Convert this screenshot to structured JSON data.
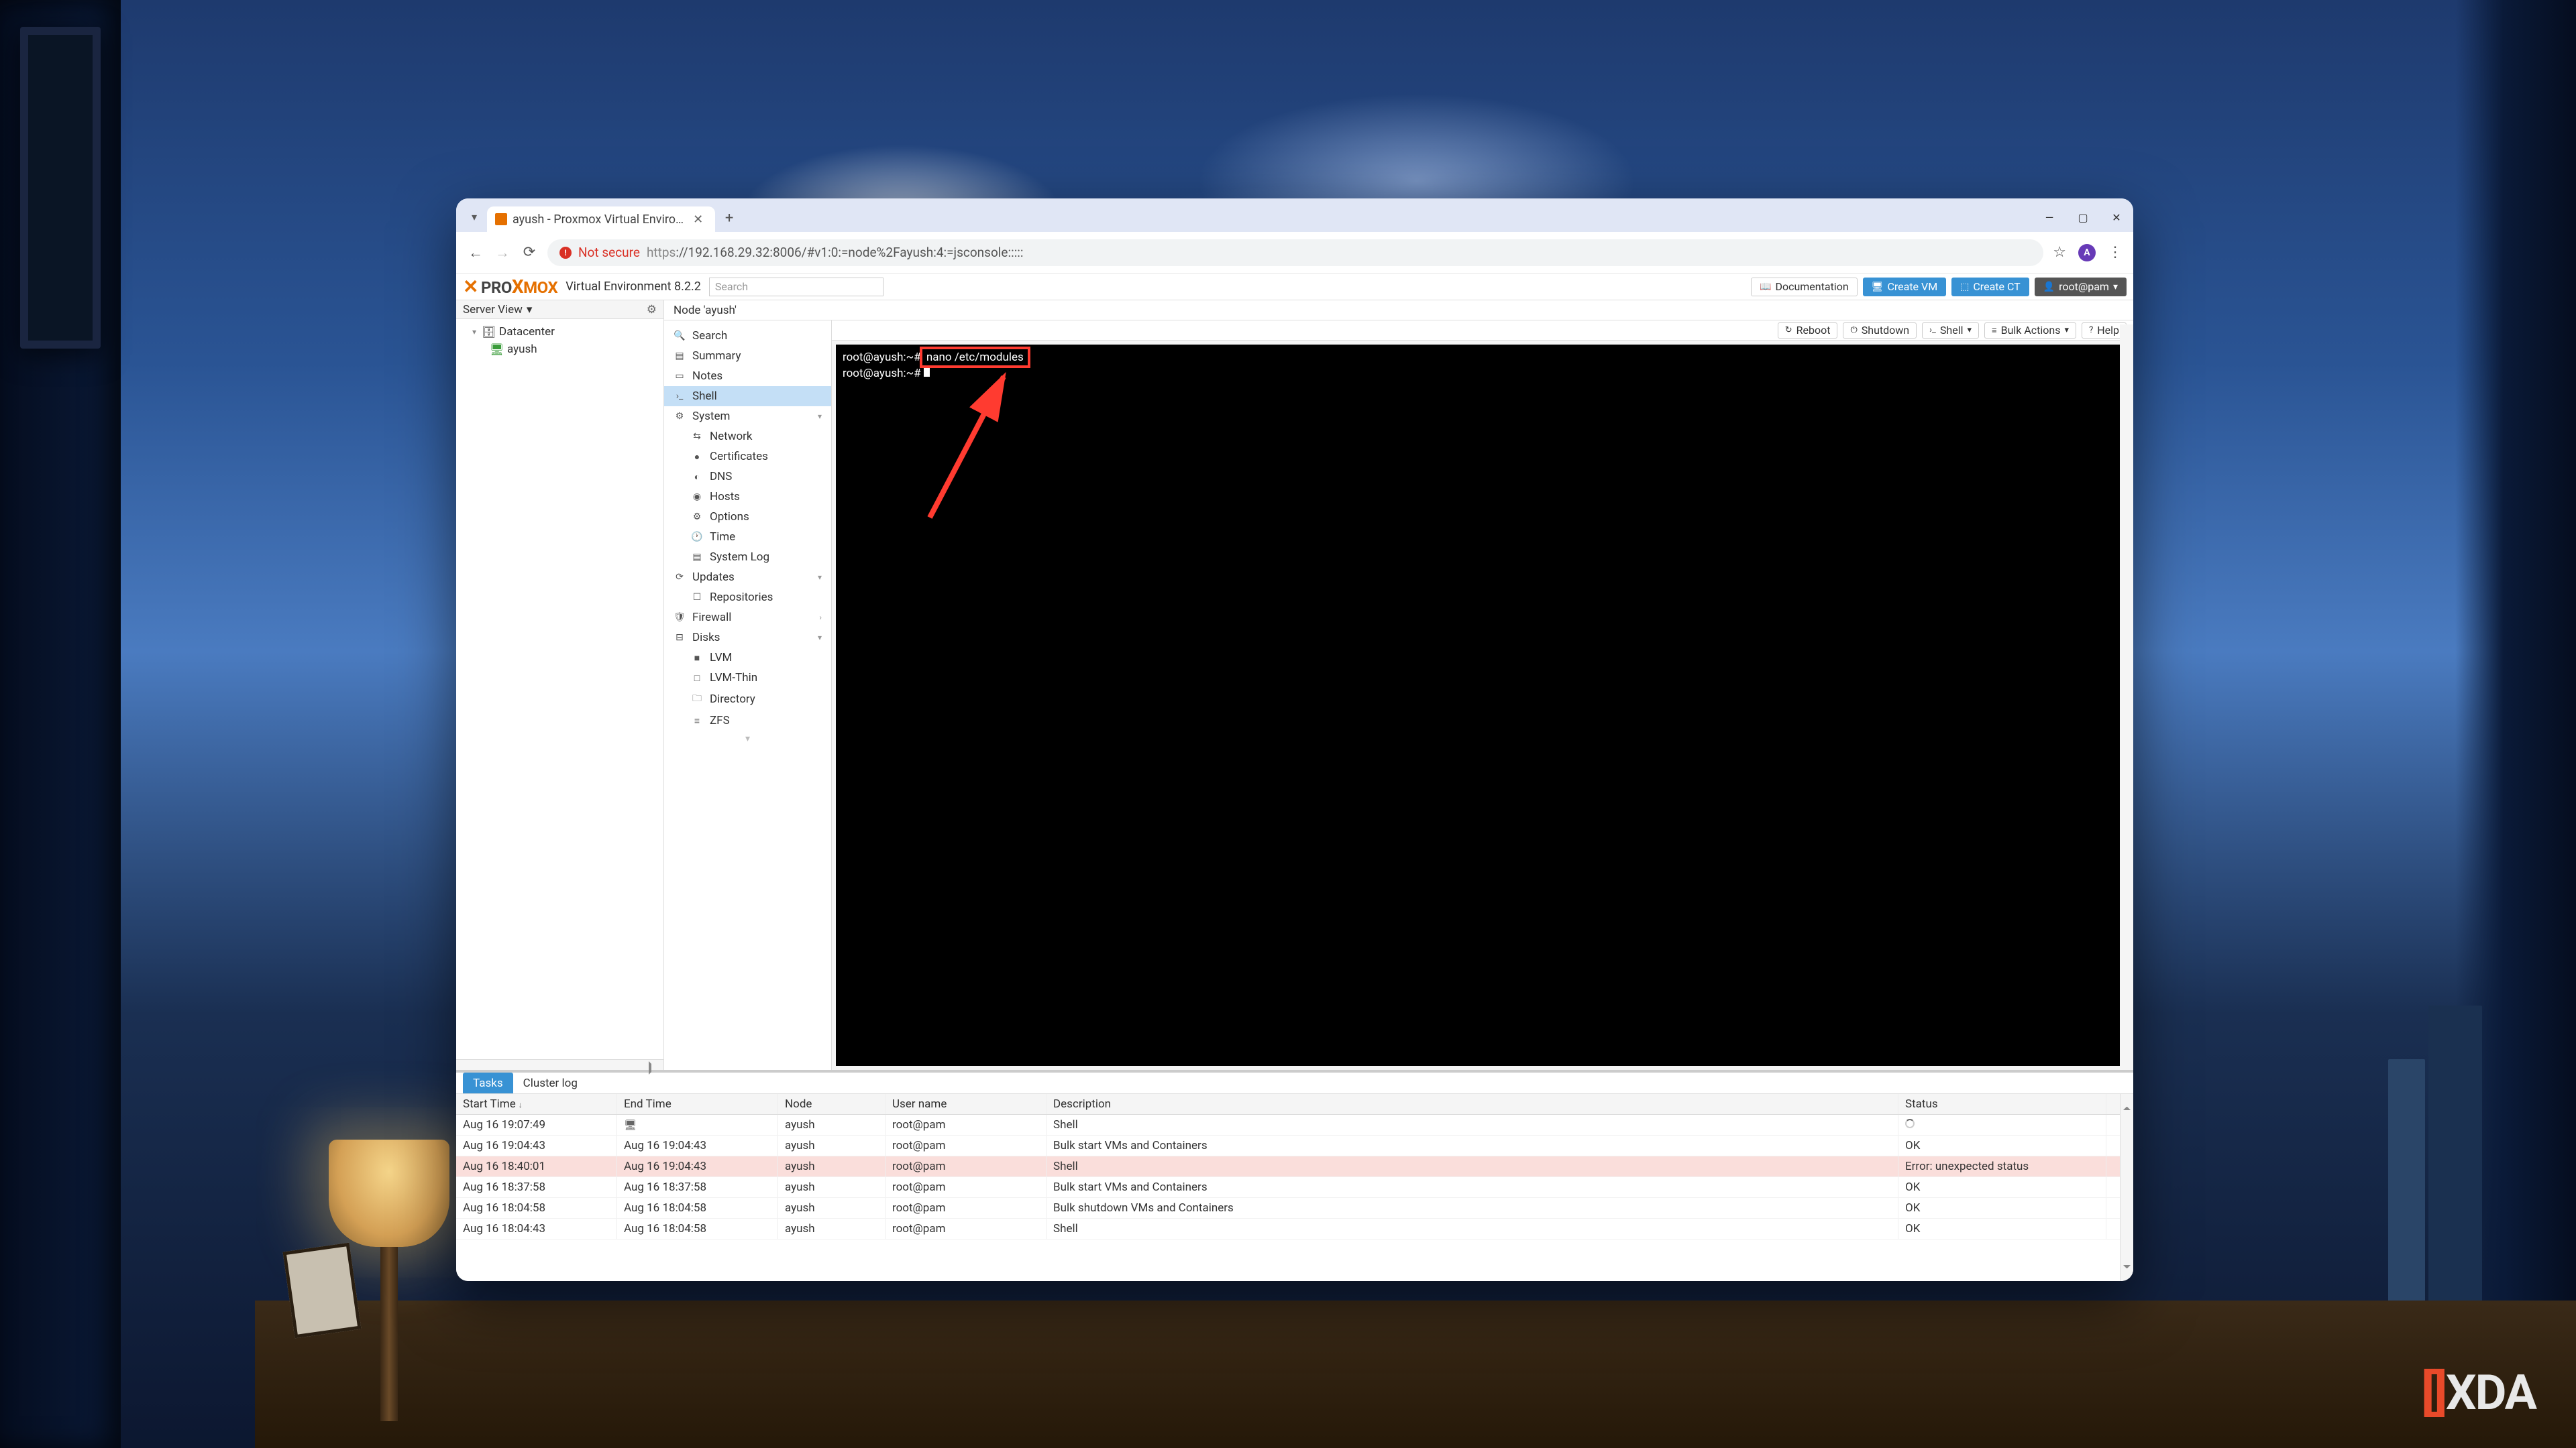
{
  "browser": {
    "tab_title": "ayush - Proxmox Virtual Enviro…",
    "security_label": "Not secure",
    "url_proto": "https",
    "url_rest": "://192.168.29.32:8006/#v1:0:=node%2Fayush:4:=jsconsole:::::",
    "avatar_initial": "A"
  },
  "proxmox": {
    "brand_pro": "PRO",
    "brand_x": "X",
    "brand_mox": "MOX",
    "ve_label": "Virtual Environment 8.2.2",
    "search_placeholder": "Search",
    "header": {
      "documentation": "Documentation",
      "create_vm": "Create VM",
      "create_ct": "Create CT",
      "user": "root@pam"
    },
    "tree": {
      "view_label": "Server View",
      "datacenter": "Datacenter",
      "node": "ayush"
    },
    "breadcrumb": "Node 'ayush'",
    "submenu": {
      "search": "Search",
      "summary": "Summary",
      "notes": "Notes",
      "shell": "Shell",
      "system": "System",
      "network": "Network",
      "certificates": "Certificates",
      "dns": "DNS",
      "hosts": "Hosts",
      "options": "Options",
      "time": "Time",
      "syslog": "System Log",
      "updates": "Updates",
      "repositories": "Repositories",
      "firewall": "Firewall",
      "disks": "Disks",
      "lvm": "LVM",
      "lvm_thin": "LVM-Thin",
      "directory": "Directory",
      "zfs": "ZFS"
    },
    "toolbar": {
      "reboot": "Reboot",
      "shutdown": "Shutdown",
      "shell": "Shell",
      "bulk": "Bulk Actions",
      "help": "Help"
    },
    "console": {
      "prompt1": "root@ayush:~#",
      "cmd1": "nano /etc/modules",
      "prompt2": "root@ayush:~#"
    },
    "log": {
      "tab_tasks": "Tasks",
      "tab_cluster": "Cluster log",
      "col_start": "Start Time",
      "col_end": "End Time",
      "col_node": "Node",
      "col_user": "User name",
      "col_desc": "Description",
      "col_status": "Status",
      "rows": [
        {
          "start": "Aug 16 19:07:49",
          "end_icon": true,
          "end": "",
          "node": "ayush",
          "user": "root@pam",
          "desc": "Shell",
          "status_spinner": true,
          "status": "",
          "err": false
        },
        {
          "start": "Aug 16 19:04:43",
          "end": "Aug 16 19:04:43",
          "node": "ayush",
          "user": "root@pam",
          "desc": "Bulk start VMs and Containers",
          "status": "OK",
          "err": false
        },
        {
          "start": "Aug 16 18:40:01",
          "end": "Aug 16 19:04:43",
          "node": "ayush",
          "user": "root@pam",
          "desc": "Shell",
          "status": "Error: unexpected status",
          "err": true
        },
        {
          "start": "Aug 16 18:37:58",
          "end": "Aug 16 18:37:58",
          "node": "ayush",
          "user": "root@pam",
          "desc": "Bulk start VMs and Containers",
          "status": "OK",
          "err": false
        },
        {
          "start": "Aug 16 18:04:58",
          "end": "Aug 16 18:04:58",
          "node": "ayush",
          "user": "root@pam",
          "desc": "Bulk shutdown VMs and Containers",
          "status": "OK",
          "err": false
        },
        {
          "start": "Aug 16 18:04:43",
          "end": "Aug 16 18:04:58",
          "node": "ayush",
          "user": "root@pam",
          "desc": "Shell",
          "status": "OK",
          "err": false
        }
      ]
    }
  },
  "watermark": {
    "bracket_open": "[",
    "bracket_close": "]",
    "text": "XDA"
  }
}
